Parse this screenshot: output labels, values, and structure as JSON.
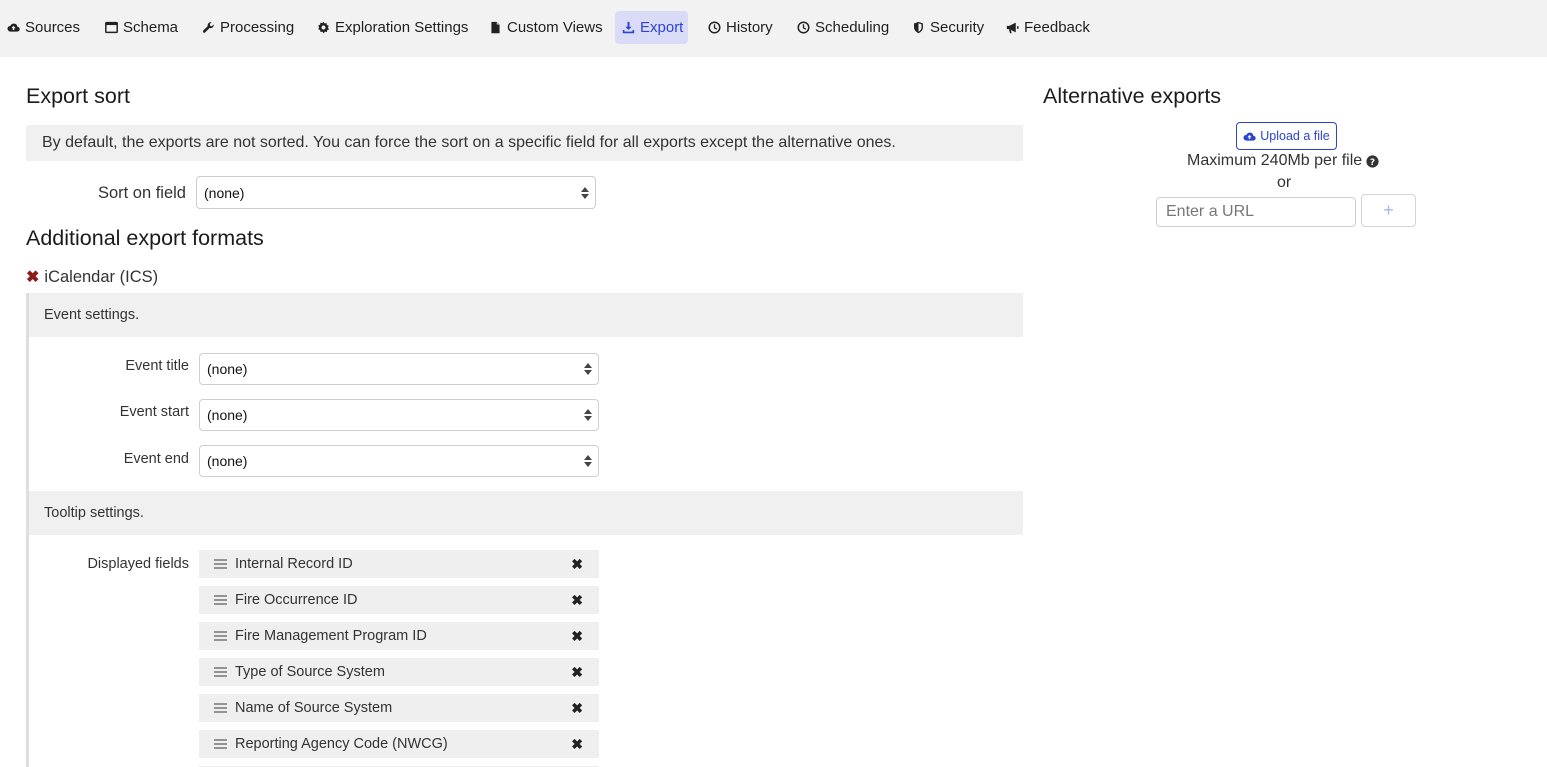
{
  "nav": {
    "tabs": [
      {
        "label": "Sources",
        "icon": "cloud-upload-icon"
      },
      {
        "label": "Schema",
        "icon": "window-icon"
      },
      {
        "label": "Processing",
        "icon": "wrench-icon"
      },
      {
        "label": "Exploration Settings",
        "icon": "gear-icon"
      },
      {
        "label": "Custom Views",
        "icon": "file-icon"
      },
      {
        "label": "Export",
        "icon": "download-icon",
        "active": true
      },
      {
        "label": "History",
        "icon": "clock-icon"
      },
      {
        "label": "Scheduling",
        "icon": "clock-icon"
      },
      {
        "label": "Security",
        "icon": "shield-icon"
      },
      {
        "label": "Feedback",
        "icon": "bullhorn-icon"
      }
    ]
  },
  "export_sort": {
    "title": "Export sort",
    "info": "By default, the exports are not sorted. You can force the sort on a specific field for all exports except the alternative ones.",
    "sort_label": "Sort on field",
    "sort_value": "(none)"
  },
  "additional": {
    "title": "Additional export formats",
    "format_name": "iCalendar (ICS)",
    "event_settings": {
      "title": "Event settings.",
      "title_label": "Event title",
      "title_value": "(none)",
      "start_label": "Event start",
      "start_value": "(none)",
      "end_label": "Event end",
      "end_value": "(none)"
    },
    "tooltip_settings": {
      "title": "Tooltip settings.",
      "displayed_label": "Displayed fields",
      "fields": [
        "Internal Record ID",
        "Fire Occurrence ID",
        "Fire Management Program ID",
        "Type of Source System",
        "Name of Source System",
        "Reporting Agency Code (NWCG)"
      ]
    }
  },
  "alternative": {
    "title": "Alternative exports",
    "upload_label": "Upload a file",
    "max_text": "Maximum 240Mb per file",
    "or_text": "or",
    "url_placeholder": "Enter a URL",
    "add_label": "+"
  },
  "colors": {
    "accent": "#2b44d1",
    "active_tab_bg": "#dadbf6",
    "remove_format": "#8b1a1a"
  }
}
